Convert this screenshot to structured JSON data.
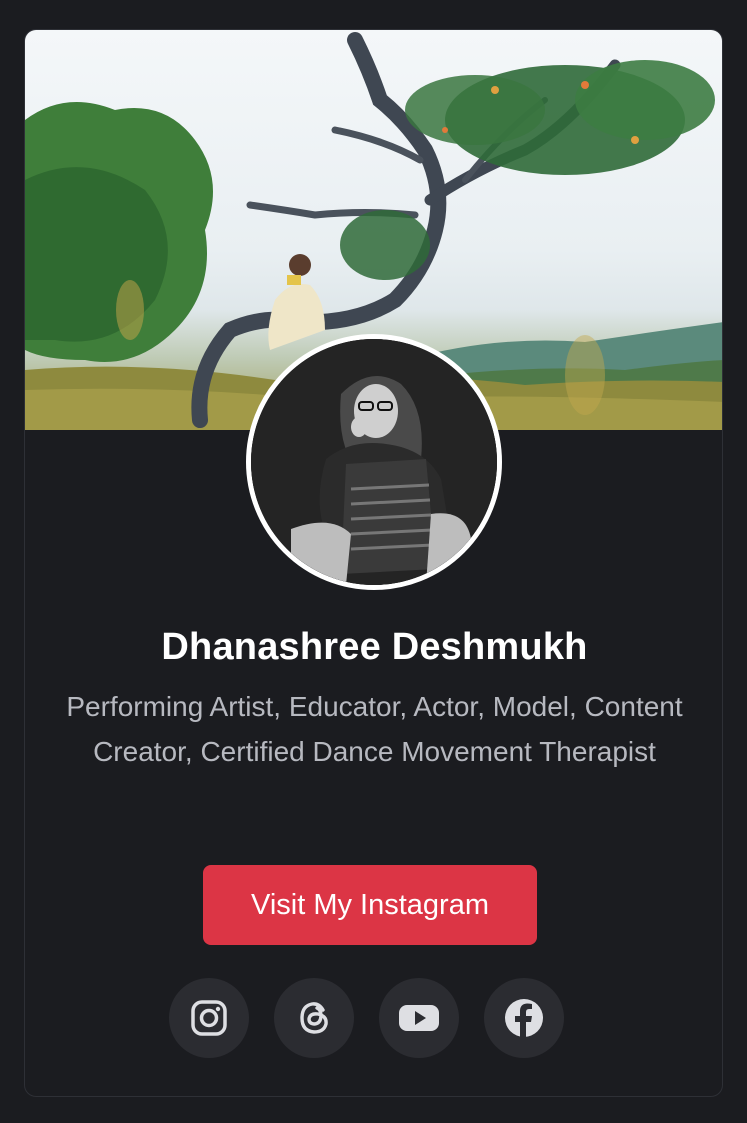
{
  "profile": {
    "name": "Dhanashree Deshmukh",
    "bio": "Performing Artist, Educator, Actor, Model, Content Creator, Certified Dance Movement Therapist"
  },
  "cta": {
    "label": "Visit My Instagram"
  },
  "socials": [
    {
      "icon": "instagram-icon"
    },
    {
      "icon": "threads-icon"
    },
    {
      "icon": "youtube-icon"
    },
    {
      "icon": "facebook-icon"
    }
  ],
  "colors": {
    "background": "#1b1c20",
    "accent": "#dc3545",
    "text_primary": "#ffffff",
    "text_secondary": "#b7b9c0",
    "social_bg": "#2b2c31"
  }
}
